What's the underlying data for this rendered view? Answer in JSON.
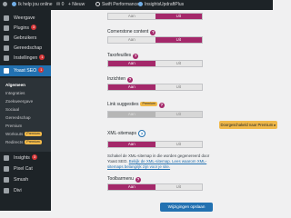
{
  "adminbar": {
    "site": "Ik help jou online",
    "comments": "0",
    "new": "+ Nieuw",
    "swift": "Swift Performance",
    "insights": "Insights",
    "updraft": "UpdraftPlus"
  },
  "menu": {
    "top_items": [
      {
        "label": "Weergave",
        "icon": "brush-icon"
      },
      {
        "label": "Plugins",
        "icon": "plug-icon",
        "count": "3"
      },
      {
        "label": "Gebruikers",
        "icon": "users-icon"
      },
      {
        "label": "Gereedschap",
        "icon": "wrench-icon"
      },
      {
        "label": "Instellingen",
        "icon": "settings-icon",
        "count": "1"
      }
    ],
    "yoast": {
      "label": "Yoast SEO",
      "count": "1",
      "icon": "yoast-icon"
    },
    "submenu": [
      {
        "label": "Algemeen",
        "current": true
      },
      {
        "label": "Integraties"
      },
      {
        "label": "Zoekweergave"
      },
      {
        "label": "Sociaal"
      },
      {
        "label": "Gereedschap"
      },
      {
        "label": "Premium"
      },
      {
        "label": "Workouts",
        "badge": "Premium"
      },
      {
        "label": "Redirects",
        "badge": "Premium"
      }
    ],
    "bottom_items": [
      {
        "label": "Insights",
        "count": "3",
        "icon": "insights-icon"
      },
      {
        "label": "Pixel Cat",
        "icon": "cat-icon"
      },
      {
        "label": "Smush",
        "icon": "smush-icon"
      },
      {
        "label": "Divi",
        "icon": "divi-icon"
      }
    ]
  },
  "settings": {
    "rows": [
      {
        "label": "",
        "on": "Aan",
        "off": "Uit",
        "state": "off"
      },
      {
        "label": "Cornerstone content",
        "on": "Aan",
        "off": "Uit",
        "state": "off"
      },
      {
        "label": "Taxofeuilles",
        "on": "Aan",
        "off": "Uit",
        "state": "on"
      },
      {
        "label": "Inzichten",
        "on": "Aan",
        "off": "Uit",
        "state": "on"
      },
      {
        "label": "Link suggesties",
        "badge": "Premium",
        "on": "Aan",
        "off": "Uit",
        "state": "disabled"
      },
      {
        "label": "XML-sitemaps",
        "on": "Aan",
        "off": "Uit",
        "state": "on"
      },
      {
        "label": "Toolbarmenu",
        "on": "Aan",
        "off": "Uit",
        "state": "on"
      }
    ],
    "promo": "Doorgeschakeld naar Premium ▸",
    "sitemap_help_1": "Schakel de XML-sitemap in die worden gegenereerd door Yoast SEO.",
    "sitemap_help_link": "Bekijk de XML-sitemap. Lees waarom XML-sitemaps belangrijk zijn voor je site.",
    "save_label": "Wijzigingen opslaan"
  },
  "colors": {
    "accent": "#a4286a",
    "wp_blue": "#2271b1",
    "premium": "#f0b849"
  }
}
